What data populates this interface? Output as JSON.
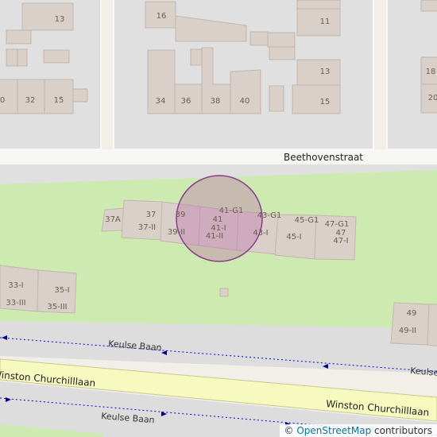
{
  "map": {
    "colors": {
      "background": "#f2efe9",
      "block": "#e0e0e0",
      "block_edge": "#ffffff",
      "building": "#d9d0c9",
      "building_edge": "#c4b6ab",
      "grass": "#cdebb0",
      "road": "#dddddd",
      "primary_road": "#f7fabf",
      "primary_road_edge": "#c8c890",
      "footway": "#0000ff",
      "marker_fill": "#c080b0",
      "marker_stroke": "#8b3a8b"
    },
    "streets": {
      "beethovenstraat": "Beethovenstraat",
      "winston_churchilllaan_west": "Winston Churchilllaan",
      "winston_churchilllaan_east": "Winston Churchilllaan"
    },
    "paths": {
      "keulse_baan_upper": "Keulse Baan",
      "keulse_baan_upper_right": "Keulse",
      "keulse_baan_lower": "Keulse Baan"
    },
    "house_numbers": {
      "n13_top": "13",
      "n16": "16",
      "n11": "11",
      "n0_left": "0",
      "n32": "32",
      "n15_left": "15",
      "n34": "34",
      "n36": "36",
      "n38": "38",
      "n40": "40",
      "n13_mid": "13",
      "n15_mid": "15",
      "n18": "18",
      "n20": "20",
      "n37A": "37A",
      "n37": "37",
      "n37II": "37-II",
      "n39": "39",
      "n39II": "39-II",
      "n41G1": "41-G1",
      "n41": "41",
      "n41I": "41-I",
      "n41II": "41-II",
      "n43G1": "43-G1",
      "n43I": "43-I",
      "n45G1": "45-G1",
      "n45I": "45-I",
      "n47G1": "47-G1",
      "n47": "47",
      "n47I": "47-I",
      "n33I": "33-I",
      "n33III": "33-III",
      "n35I": "35-I",
      "n35III": "35-III",
      "n49": "49",
      "n49II": "49-II"
    },
    "marker": {
      "shape": "circle"
    }
  },
  "attribution": {
    "copyright": "©",
    "link_text": "OpenStreetMap",
    "suffix": "contributors"
  }
}
